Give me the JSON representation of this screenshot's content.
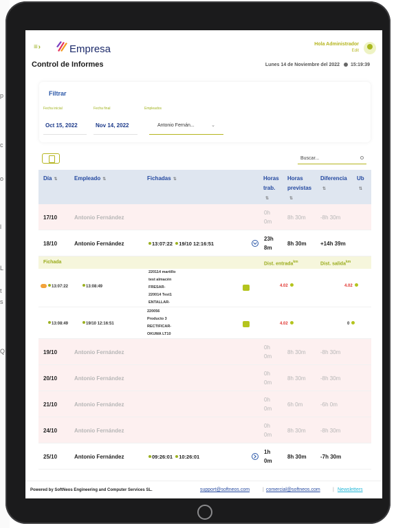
{
  "header": {
    "brand": "Empresa",
    "greeting": "Hola Administrador",
    "edit_label": "Edit"
  },
  "page": {
    "title": "Control de Informes",
    "date": "Lunes 14 de Noviembre del 2022",
    "time": "15:19:39"
  },
  "filter": {
    "title": "Filtrar",
    "start_label": "Fecha inicial",
    "start_value": "Oct 15, 2022",
    "end_label": "Fecha final",
    "end_value": "Nov 14, 2022",
    "employee_label": "Empleados",
    "employee_value": "Antonio Fernán..."
  },
  "search": {
    "placeholder": "Buscar..."
  },
  "table": {
    "headers": {
      "dia": "Día",
      "empleado": "Empleado",
      "fichadas": "Fichadas",
      "horas_trab_1": "Horas",
      "horas_trab_2": "trab.",
      "horas_prev_1": "Horas",
      "horas_prev_2": "previstas",
      "diferencia": "Diferencia",
      "ub": "Ub",
      "sort": "⇅"
    },
    "rows": [
      {
        "dia": "17/10",
        "empleado": "Antonio Fernández",
        "horas1": "0h",
        "horas2": "0m",
        "prev": "8h 30m",
        "dif": "-8h 30m"
      },
      {
        "dia": "18/10",
        "empleado": "Antonio Fernández",
        "f1": "13:07:22",
        "f2": "19/10 12:16:51",
        "horas1": "23h",
        "horas2": "8m",
        "prev": "8h 30m",
        "dif": "+14h 39m"
      },
      {
        "dia": "19/10",
        "empleado": "Antonio Fernández",
        "horas1": "0h",
        "horas2": "0m",
        "prev": "8h 30m",
        "dif": "-8h 30m"
      },
      {
        "dia": "20/10",
        "empleado": "Antonio Fernández",
        "horas1": "0h",
        "horas2": "0m",
        "prev": "8h 30m",
        "dif": "-8h 30m"
      },
      {
        "dia": "21/10",
        "empleado": "Antonio Fernández",
        "horas1": "0h",
        "horas2": "0m",
        "prev": "6h 0m",
        "dif": "-6h 0m"
      },
      {
        "dia": "24/10",
        "empleado": "Antonio Fernández",
        "horas1": "0h",
        "horas2": "0m",
        "prev": "8h 30m",
        "dif": "-8h 30m"
      },
      {
        "dia": "25/10",
        "empleado": "Antonio Fernández",
        "f1": "09:26:01",
        "f2": "10:26:01",
        "horas1": "1h",
        "horas2": "0m",
        "prev": "8h 30m",
        "dif": "-7h 30m"
      }
    ],
    "detail": {
      "head_fichada": "Fichada",
      "head_entrada": "Dist. entrada",
      "head_salida": "Dist. salida",
      "km": "km",
      "items": [
        {
          "start": "13:07:22",
          "end": "13:08:49",
          "desc": [
            "220114 martillo",
            "test almacén",
            "FRESAR-",
            "220014 Test1",
            "ENTALLAR-"
          ],
          "dist_in": "4.02",
          "dist_out": "4.02"
        },
        {
          "start": "13:08:49",
          "end": "19/10 12:16:51",
          "desc": [
            "220056",
            "Producto 3",
            "RECTIFICAR-",
            "OKUMA LT10"
          ],
          "dist_in": "4.02",
          "dist_out": "0"
        }
      ]
    }
  },
  "footer": {
    "powered": "Powered by SoftNeos Engineering and Computer Services SL.",
    "support": "support@softneos.com",
    "sales": "comercial@softneos.com",
    "newsletter": "Newsletters",
    "sep": "|"
  },
  "background_fragments": [
    "p",
    "c",
    "o",
    "l",
    "L",
    "t",
    "s",
    "Q"
  ],
  "colors": {
    "accent": "#b4b41c",
    "primary": "#2449a0",
    "pink_row": "#fdf0f0"
  }
}
